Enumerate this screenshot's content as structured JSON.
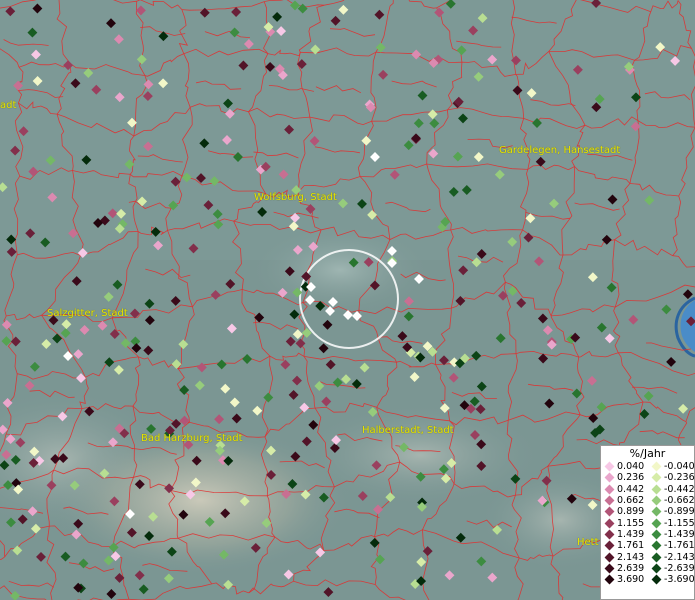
{
  "places": [
    {
      "id": "wolfsburg",
      "label": "Wolfsburg, Stadt"
    },
    {
      "id": "gardelegen",
      "label": "Gardelegen, Hansestadt"
    },
    {
      "id": "salzgitter",
      "label": "Salzgitter, Stadt"
    },
    {
      "id": "badharzburg",
      "label": "Bad Harzburg, Stadt"
    },
    {
      "id": "halberstadt",
      "label": "Halberstadt, Stadt"
    },
    {
      "id": "hett",
      "label": "Hett"
    },
    {
      "id": "left_edge",
      "label": "adt"
    }
  ],
  "legend": {
    "title": "%/Jahr",
    "positive": [
      {
        "label": "0.040",
        "color": "#f7c8e6"
      },
      {
        "label": "0.236",
        "color": "#eaa6cc"
      },
      {
        "label": "0.442",
        "color": "#dc8ab0"
      },
      {
        "label": "0.662",
        "color": "#c86f92"
      },
      {
        "label": "0.899",
        "color": "#b25577"
      },
      {
        "label": "1.155",
        "color": "#9a405f"
      },
      {
        "label": "1.439",
        "color": "#822f4b"
      },
      {
        "label": "1.761",
        "color": "#6a2039"
      },
      {
        "label": "2.143",
        "color": "#521428"
      },
      {
        "label": "2.639",
        "color": "#3a0a1a"
      },
      {
        "label": "3.690",
        "color": "#22040d"
      }
    ],
    "negative": [
      {
        "label": "-0.040",
        "color": "#f2f7c8"
      },
      {
        "label": "-0.236",
        "color": "#d6eca8"
      },
      {
        "label": "-0.442",
        "color": "#b8de92"
      },
      {
        "label": "-0.662",
        "color": "#96cc7c"
      },
      {
        "label": "-0.899",
        "color": "#74b866"
      },
      {
        "label": "-1.155",
        "color": "#56a452"
      },
      {
        "label": "-1.439",
        "color": "#3c8c40"
      },
      {
        "label": "-1.761",
        "color": "#28752f"
      },
      {
        "label": "-2.143",
        "color": "#185c22"
      },
      {
        "label": "-2.639",
        "color": "#0c4416"
      },
      {
        "label": "-3.690",
        "color": "#042b0b"
      }
    ]
  },
  "colors": {
    "boundary": "#e03030",
    "label": "#e8e400",
    "water": "#4a8cc8",
    "highlight": "#ffffff"
  }
}
